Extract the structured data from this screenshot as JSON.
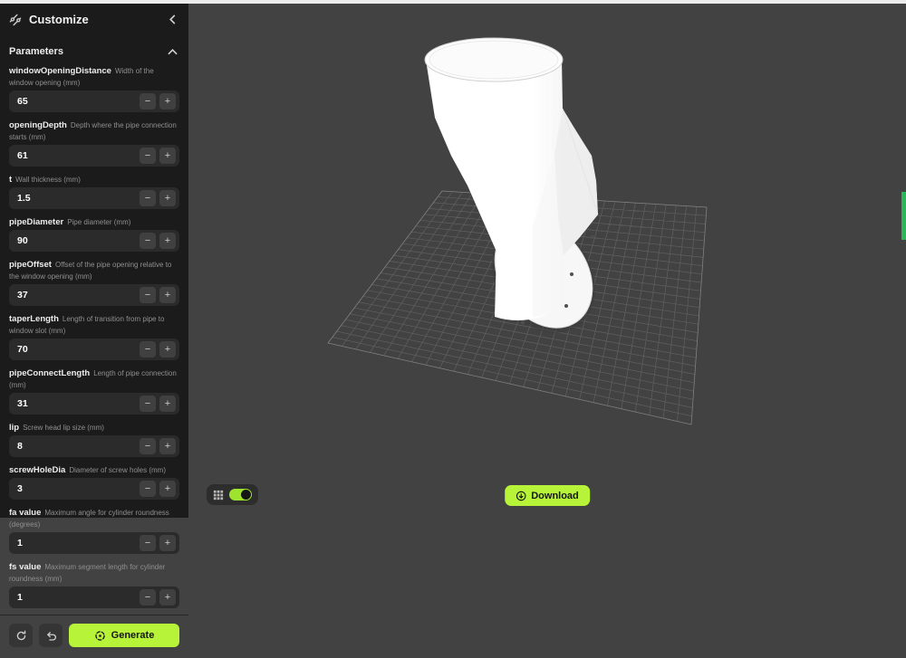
{
  "header": {
    "title": "Customize"
  },
  "parameters_section": {
    "label": "Parameters"
  },
  "parameters": [
    {
      "name": "windowOpeningDistance",
      "description": "Width of the window opening (mm)",
      "value": "65"
    },
    {
      "name": "openingDepth",
      "description": "Depth where the pipe connection starts (mm)",
      "value": "61"
    },
    {
      "name": "t",
      "description": "Wall thickness (mm)",
      "value": "1.5"
    },
    {
      "name": "pipeDiameter",
      "description": "Pipe diameter (mm)",
      "value": "90"
    },
    {
      "name": "pipeOffset",
      "description": "Offset of the pipe opening relative to the window opening (mm)",
      "value": "37"
    },
    {
      "name": "taperLength",
      "description": "Length of transition from pipe to window slot (mm)",
      "value": "70"
    },
    {
      "name": "pipeConnectLength",
      "description": "Length of pipe connection (mm)",
      "value": "31"
    },
    {
      "name": "lip",
      "description": "Screw head lip size (mm)",
      "value": "8"
    },
    {
      "name": "screwHoleDia",
      "description": "Diameter of screw holes (mm)",
      "value": "3"
    },
    {
      "name": "fa value",
      "description": "Maximum angle for cylinder roundness (degrees)",
      "value": "1"
    },
    {
      "name": "fs value",
      "description": "Maximum segment length for cylinder roundness (mm)",
      "value": "1"
    }
  ],
  "stepper": {
    "minus": "−",
    "plus": "+"
  },
  "footer": {
    "generate_label": "Generate"
  },
  "viewer": {
    "download_label": "Download",
    "grid_toggle_on": true
  },
  "icons": [
    "customize-sliders-icon",
    "collapse-chevron-left-icon",
    "section-chevron-up-icon",
    "minus-icon",
    "plus-icon",
    "regenerate-icon",
    "undo-icon",
    "generate-orbit-icon",
    "grid-icon",
    "toggle-switch",
    "download-circle-arrow-icon"
  ],
  "colors": {
    "accent_lime": "#b6f339",
    "toggle_green": "#9ee42f",
    "edge_indicator_green": "#2ab757",
    "canvas_bg": "#424242",
    "sidebar_bg": "#1b1b1b",
    "model_color": "#ffffff"
  }
}
